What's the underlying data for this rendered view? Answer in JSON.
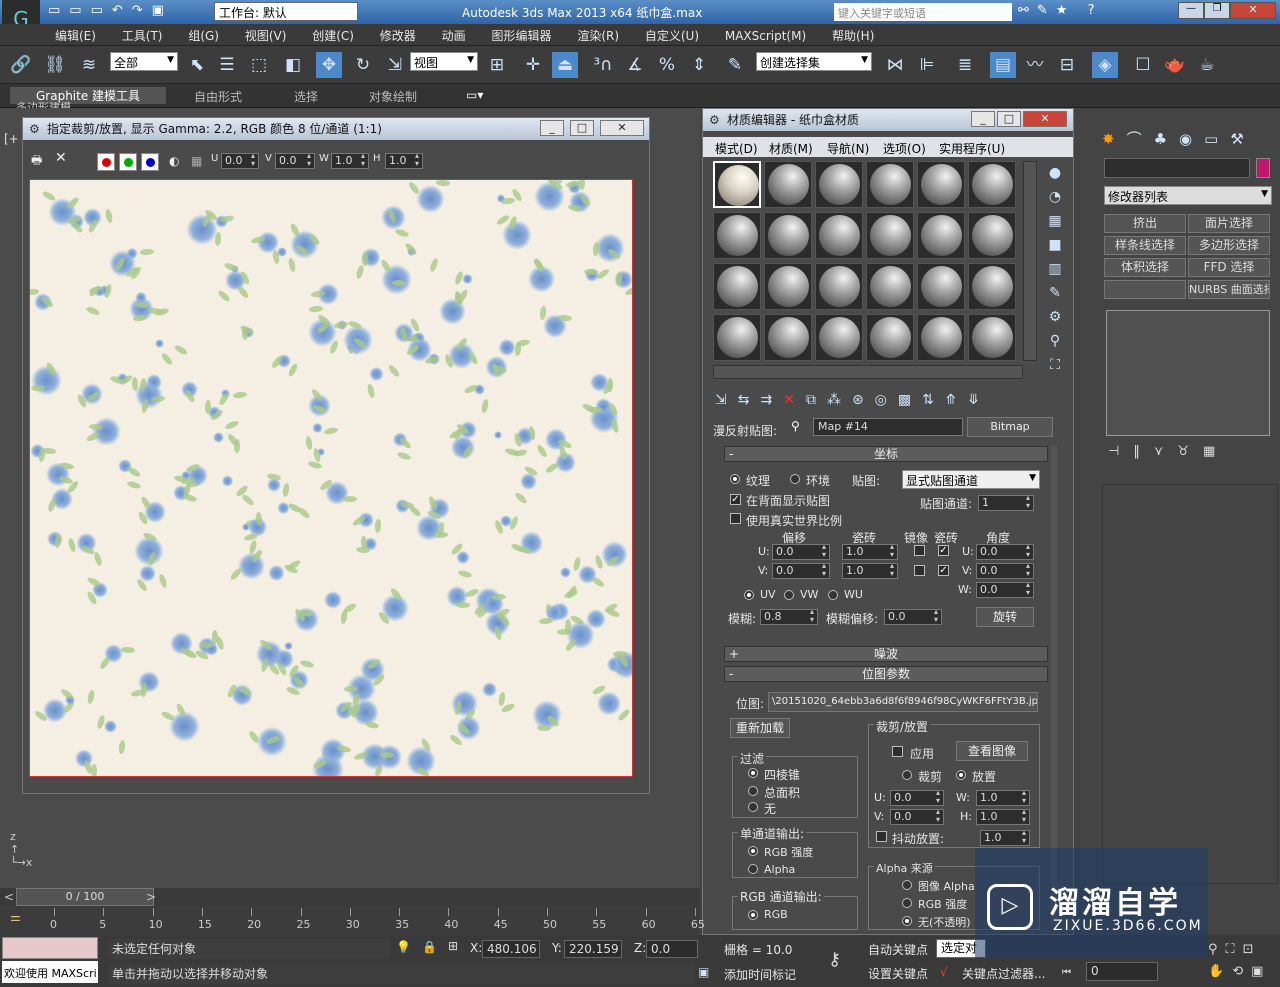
{
  "app": {
    "title": "Autodesk 3ds Max  2013 x64      纸巾盒.max",
    "workspace": "工作台: 默认",
    "search_placeholder": "键入关键字或短语"
  },
  "menu": [
    "编辑(E)",
    "工具(T)",
    "组(G)",
    "视图(V)",
    "创建(C)",
    "修改器",
    "动画",
    "图形编辑器",
    "渲染(R)",
    "自定义(U)",
    "MAXScript(M)",
    "帮助(H)"
  ],
  "toolbar": {
    "filter": "全部",
    "ref_coord": "视图",
    "selection_set": "创建选择集"
  },
  "ribbon": {
    "tabs": [
      "Graphite 建模工具",
      "自由形式",
      "选择",
      "对象绘制"
    ],
    "sub": "多边形建模"
  },
  "viewport": {
    "label": "[+"
  },
  "crop_window": {
    "title": "指定裁剪/放置, 显示 Gamma: 2.2, RGB 颜色 8 位/通道 (1:1)",
    "u": "0.0",
    "v": "0.0",
    "w": "1.0",
    "h": "1.0",
    "u_lbl": "U",
    "v_lbl": "V",
    "w_lbl": "W",
    "h_lbl": "H"
  },
  "mat_editor": {
    "title": "材质编辑器 - 纸巾盒材质",
    "menus": [
      "模式(D)",
      "材质(M)",
      "导航(N)",
      "选项(O)",
      "实用程序(U)"
    ],
    "map_label": "漫反射贴图:",
    "map_name": "Map #14",
    "map_type": "Bitmap",
    "coords": {
      "title": "坐标",
      "texture": "纹理",
      "environ": "环境",
      "mapping_lbl": "贴图:",
      "mapping": "显式贴图通道",
      "show_back": "在背面显示贴图",
      "map_channel_lbl": "贴图通道:",
      "map_channel": "1",
      "real_world": "使用真实世界比例",
      "offset": "偏移",
      "tiling": "瓷砖",
      "mirror": "镜像",
      "tile": "瓷砖",
      "angle": "角度",
      "u": "U:",
      "v": "V:",
      "w": "W:",
      "u_off": "0.0",
      "v_off": "0.0",
      "u_tile": "1.0",
      "v_tile": "1.0",
      "u_ang": "0.0",
      "v_ang": "0.0",
      "w_ang": "0.0",
      "uv": "UV",
      "vw": "VW",
      "wu": "WU",
      "blur_lbl": "模糊:",
      "blur": "0.8",
      "blur_off_lbl": "模糊偏移:",
      "blur_off": "0.0",
      "rotate": "旋转"
    },
    "noise": "噪波",
    "bitmap": {
      "title": "位图参数",
      "path_lbl": "位图:",
      "path": "\\20151020_64ebb3a6d8f6f8946f98CyWKF6FFtY3B.jpg",
      "reload": "重新加载",
      "crop_title": "裁剪/放置",
      "apply": "应用",
      "view_image": "查看图像",
      "crop": "裁剪",
      "place": "放置",
      "u": "0.0",
      "v": "0.0",
      "w": "1.0",
      "h": "1.0",
      "jitter": "抖动放置:",
      "jitter_val": "1.0",
      "filter_title": "过滤",
      "f1": "四棱锥",
      "f2": "总面积",
      "f3": "无",
      "mono_title": "单通道输出:",
      "m1": "RGB 强度",
      "m2": "Alpha",
      "rgb_title": "RGB 通道输出:",
      "r1": "RGB",
      "alpha_title": "Alpha 来源",
      "a1": "图像 Alpha",
      "a2": "RGB 强度",
      "a3": "无(不透明)"
    }
  },
  "command_panel": {
    "modifier_list": "修改器列表",
    "buttons": [
      "挤出",
      "面片选择",
      "样条线选择",
      "多边形选择",
      "体积选择",
      "FFD 选择",
      "",
      "NURBS 曲面选择"
    ],
    "color": "#c2186b"
  },
  "timeline": {
    "frame": "0 / 100",
    "ticks": [
      "0",
      "5",
      "10",
      "15",
      "20",
      "25",
      "30",
      "35",
      "40",
      "45",
      "50",
      "55",
      "60",
      "65"
    ]
  },
  "status": {
    "welcome": "欢迎使用 MAXScri",
    "msg1": "未选定任何对象",
    "msg2": "单击并拖动以选择并移动对象",
    "x_lbl": "X:",
    "x": "480.106",
    "y_lbl": "Y:",
    "y": "220.159",
    "z_lbl": "Z:",
    "z": "0.0",
    "grid": "栅格 = 10.0",
    "add_tag": "添加时间标记",
    "autokey": "自动关键点",
    "selected": "选定对象",
    "setkey": "设置关键点",
    "keyfilter": "关键点过滤器...",
    "frame": "0"
  },
  "watermark": {
    "name": "溜溜自学",
    "url": "ZIXUE.3D66.COM"
  }
}
